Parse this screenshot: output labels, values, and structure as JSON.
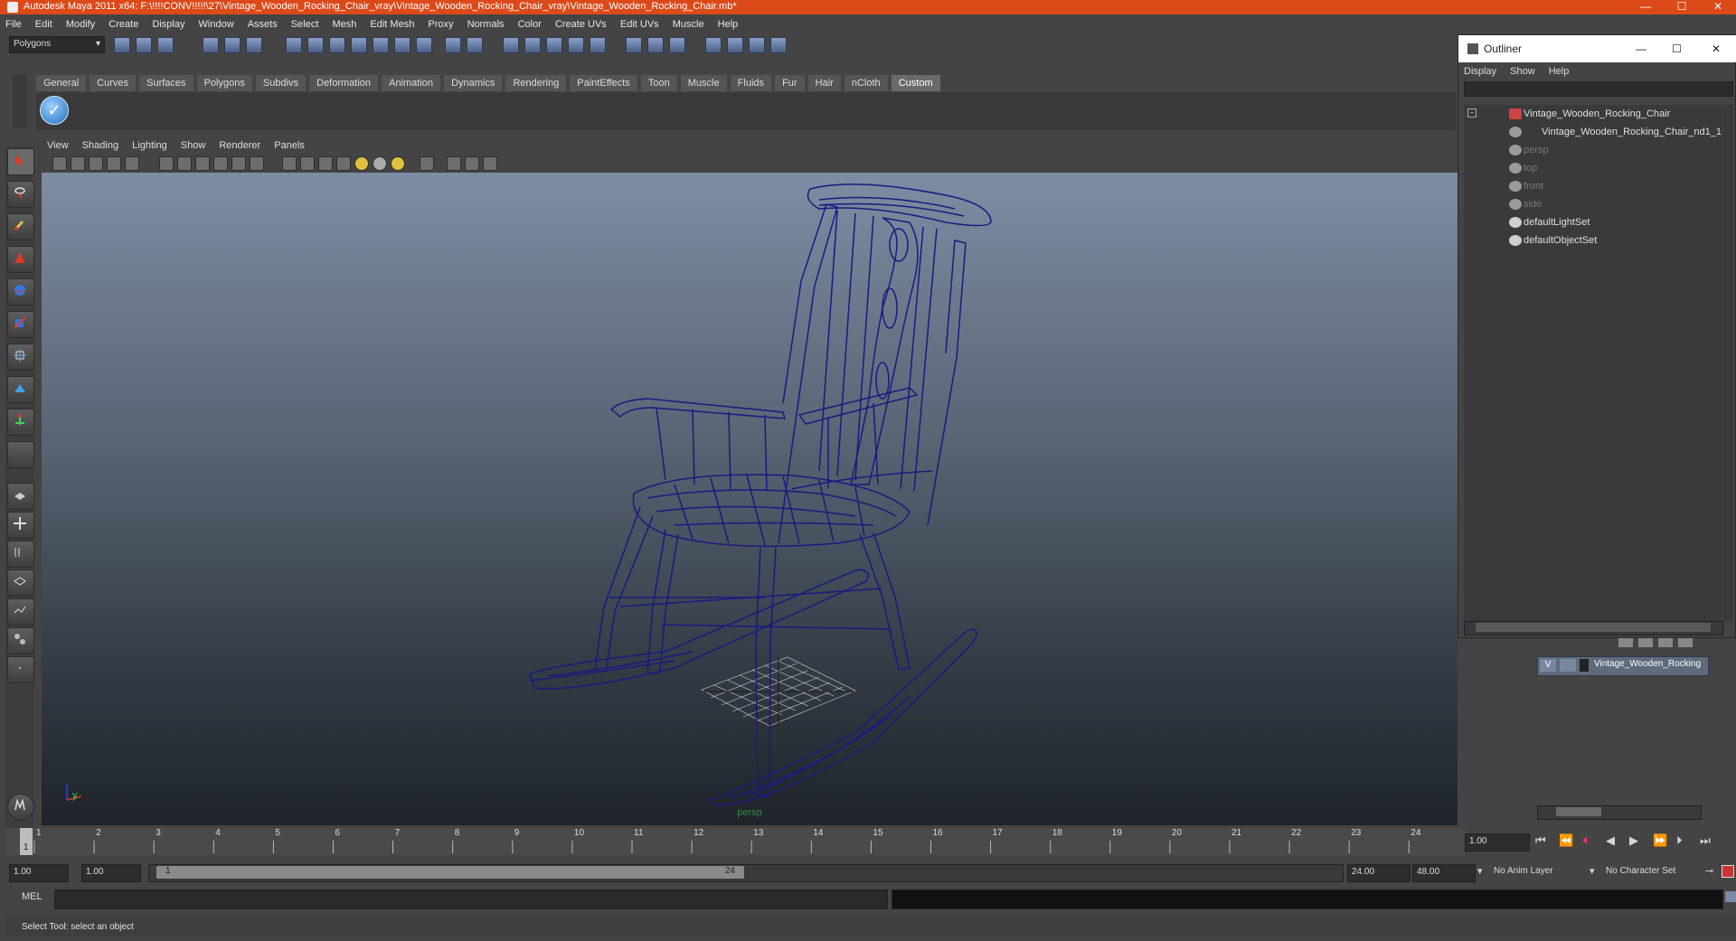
{
  "window": {
    "title": "Autodesk Maya 2011 x64: F:\\!!!!CONV!!!!!\\27\\Vintage_Wooden_Rocking_Chair_vray\\Vintage_Wooden_Rocking_Chair_vray\\Vintage_Wooden_Rocking_Chair.mb*",
    "minimize": "—",
    "maximize": "☐",
    "close": "✕"
  },
  "menubar": [
    "File",
    "Edit",
    "Modify",
    "Create",
    "Display",
    "Window",
    "Assets",
    "Select",
    "Mesh",
    "Edit Mesh",
    "Proxy",
    "Normals",
    "Color",
    "Create UVs",
    "Edit UVs",
    "Muscle",
    "Help"
  ],
  "toolbar": {
    "mode": "Polygons"
  },
  "shelf": {
    "tabs": [
      "General",
      "Curves",
      "Surfaces",
      "Polygons",
      "Subdivs",
      "Deformation",
      "Animation",
      "Dynamics",
      "Rendering",
      "PaintEffects",
      "Toon",
      "Muscle",
      "Fluids",
      "Fur",
      "Hair",
      "nCloth",
      "Custom"
    ],
    "active_tab": "Custom"
  },
  "viewport": {
    "menu": [
      "View",
      "Shading",
      "Lighting",
      "Show",
      "Renderer",
      "Panels"
    ],
    "camera_label": "persp",
    "axis_y": "y",
    "wire_color": "#1a1a80"
  },
  "timeline": {
    "ticks": [
      "1",
      "2",
      "3",
      "4",
      "5",
      "6",
      "7",
      "8",
      "9",
      "10",
      "11",
      "12",
      "13",
      "14",
      "15",
      "16",
      "17",
      "18",
      "19",
      "20",
      "21",
      "22",
      "23",
      "24"
    ],
    "current_frame": "1.00",
    "current_label": "1"
  },
  "range": {
    "start": "1.00",
    "start2": "1.00",
    "slider_start": "1",
    "slider_end": "24",
    "end": "24.00",
    "end2": "48.00",
    "anim_layer": "No Anim Layer",
    "char_set": "No Character Set"
  },
  "cmdline": {
    "label": "MEL"
  },
  "helpline": {
    "text": "Select Tool: select an object"
  },
  "outliner": {
    "title": "Outliner",
    "menu": [
      "Display",
      "Show",
      "Help"
    ],
    "items": [
      {
        "label": "Vintage_Wooden_Rocking_Chair",
        "dim": false
      },
      {
        "label": "Vintage_Wooden_Rocking_Chair_nd1_1",
        "dim": false
      },
      {
        "label": "persp",
        "dim": true
      },
      {
        "label": "top",
        "dim": true
      },
      {
        "label": "front",
        "dim": true
      },
      {
        "label": "side",
        "dim": true
      },
      {
        "label": "defaultLightSet",
        "dim": false
      },
      {
        "label": "defaultObjectSet",
        "dim": false
      }
    ]
  },
  "layers": {
    "visible_flag": "V",
    "layer_name": "Vintage_Wooden_Rocking"
  }
}
